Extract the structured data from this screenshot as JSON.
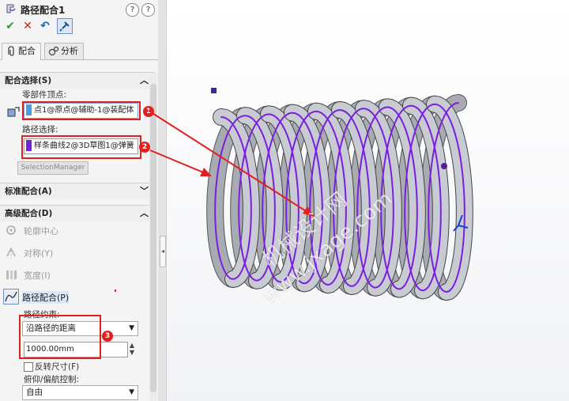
{
  "feature": {
    "title": "路径配合1",
    "help_label": "?",
    "info_label": "?"
  },
  "toolbar": {
    "ok_label": "✔",
    "cancel_label": "✕",
    "undo_label": "↶",
    "pin_label": "📌"
  },
  "tabs": [
    {
      "label": "配合"
    },
    {
      "label": "分析"
    }
  ],
  "mate_selection": {
    "header": "配合选择(S)",
    "vertex_label": "零部件顶点:",
    "vertex_value": "点1@原点@辅助-1@装配体",
    "path_label": "路径选择:",
    "path_value": "样条曲线2@3D草图1@弹簧",
    "selection_manager": "SelectionManager"
  },
  "standard_mates": {
    "header": "标准配合(A)"
  },
  "advanced_mates": {
    "header": "高级配合(D)",
    "items": [
      {
        "label": "轮廓中心",
        "enabled": false
      },
      {
        "label": "对称(Y)",
        "enabled": false
      },
      {
        "label": "宽度(I)",
        "enabled": false
      },
      {
        "label": "路径配合(P)",
        "enabled": true
      }
    ],
    "path_constraint_label": "路径约束:",
    "path_constraint_value": "沿路径的距离",
    "distance_value": "1000.00mm",
    "flip_label": "反转尺寸(F)",
    "pitch_yaw_label": "俯仰/偏航控制:",
    "pitch_yaw_value": "自由"
  },
  "callouts": [
    "1",
    "2",
    "3"
  ],
  "watermark": {
    "line1": "机械设计网",
    "line2": "www.jxage.com"
  },
  "colors": {
    "accent": "#7a1fe0",
    "callout": "#e02020",
    "coil_body": "#c9cbd3"
  }
}
